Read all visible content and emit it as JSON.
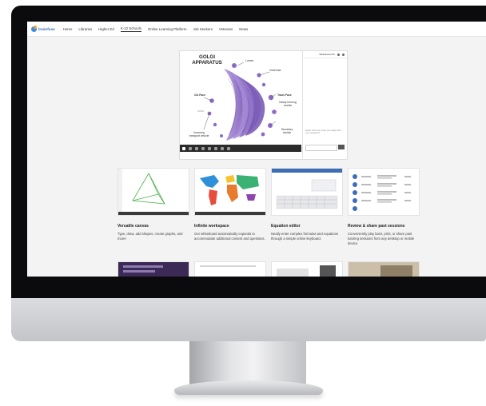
{
  "nav": {
    "logo": "brainfuse",
    "items": [
      "Home",
      "Libraries",
      "Higher Ed",
      "K-12 Schools",
      "Online Learning Platform",
      "Job Seekers",
      "Veterans",
      "News"
    ],
    "active_index": 3
  },
  "whiteboard": {
    "title_line1": "GOLGI",
    "title_line2": "APPARATUS",
    "labels": {
      "lumen": "Lumen",
      "cisternae": "Cisternae",
      "cis_face": "Cis Face",
      "trans_face": "Trans Face",
      "newly_forming_1": "Newly forming",
      "newly_forming_2": "vesicle",
      "incoming_1": "Incoming",
      "incoming_2": "transport vesicle",
      "secretory_1": "Secretory",
      "secretory_2": "vesicle"
    },
    "chat_name": "Whiteboard Kit",
    "chat_message": "Hello! how can I help you today with your question?"
  },
  "features": [
    {
      "title": "Versatile canvas",
      "desc": "Type, draw, add shapes, create graphs, and more!"
    },
    {
      "title": "Infinite workspace",
      "desc": "Our whiteboard automatically expands to accommodate additional content and questions."
    },
    {
      "title": "Equation editor",
      "desc": "Neatly enter complex formulas and equations through a simple online keyboard."
    },
    {
      "title": "Review & share past sessions",
      "desc": "Conveniently play back, print, or share past tutoring sessions from any desktop or mobile device."
    }
  ],
  "colors": {
    "golgi": "#9b7ccc",
    "golgi_dark": "#6e4fa8",
    "accent_blue": "#3c8ddc",
    "bezel": "#0b0b0d"
  }
}
